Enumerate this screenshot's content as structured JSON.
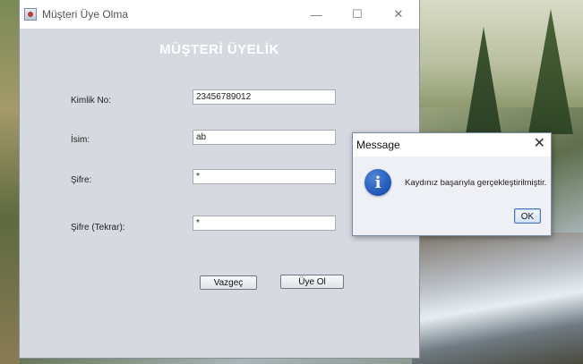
{
  "window": {
    "title": "Müşteri Üye Olma",
    "controls": {
      "minimize": "—",
      "maximize": "☐",
      "close": "✕"
    }
  },
  "form": {
    "title": "MÜŞTERİ ÜYELİK",
    "fields": [
      {
        "label": "Kimlik No:",
        "value": "23456789012"
      },
      {
        "label": "İsim:",
        "value": "ab"
      },
      {
        "label": "Şifre:",
        "value": "*"
      },
      {
        "label": "Şifre (Tekrar):",
        "value": "*"
      }
    ],
    "buttons": {
      "cancel": "Vazgeç",
      "submit": "Üye Ol"
    }
  },
  "dialog": {
    "title": "Message",
    "close": "✕",
    "icon": "info-icon",
    "icon_glyph": "i",
    "message": "Kaydınız başarıyla gerçekleştirilmiştir.",
    "ok": "OK"
  },
  "colors": {
    "form_title": "#ffffff",
    "window_bg": "#d6d9e0",
    "info_icon": "#1f56b8"
  }
}
